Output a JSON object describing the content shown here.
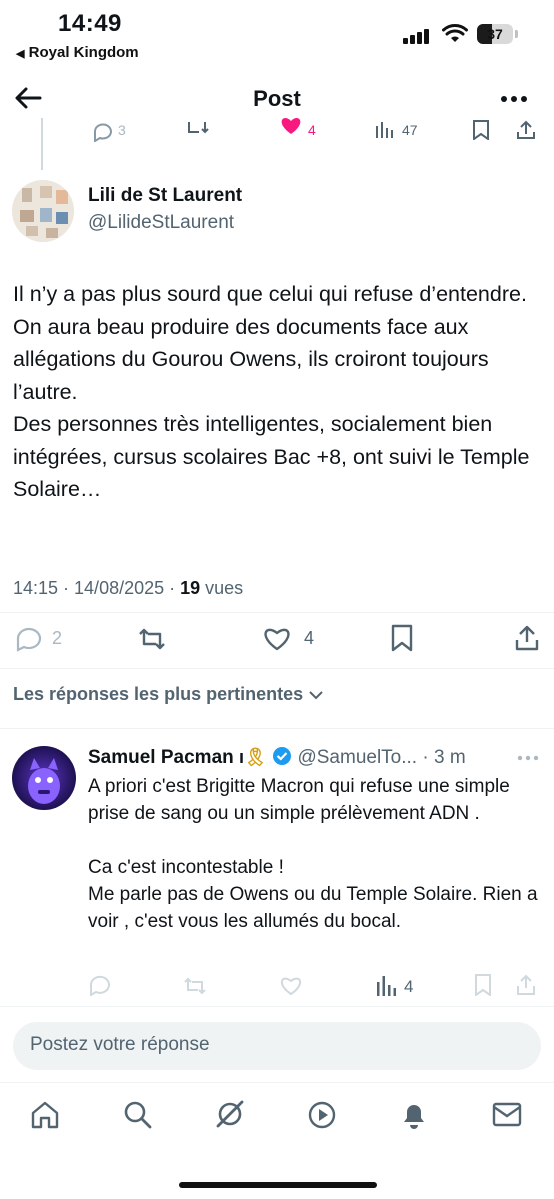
{
  "status_bar": {
    "time": "14:49",
    "carrier": "Royal Kingdom",
    "battery": "37"
  },
  "header": {
    "title": "Post"
  },
  "prev_tweet_stats": {
    "replies": "3",
    "likes": "4",
    "views": "47"
  },
  "tweet": {
    "author_name": "Lili de St Laurent",
    "author_handle": "@LilideStLaurent",
    "text": "Il n’y a pas plus sourd que celui qui refuse d’entendre.\nOn aura beau produire des documents face aux allégations du Gourou Owens, ils croiront toujours l’autre.\nDes personnes très intelligentes, socialement bien intégrées, cursus scolaires Bac +8, ont suivi le Temple Solaire…",
    "meta_time": "14:15 · 14/08/2025 · ",
    "views_count": "19",
    "views_label": " vues",
    "replies": "2",
    "likes": "4"
  },
  "replies_sort": {
    "label": "Les réponses les plus pertinentes"
  },
  "reply": {
    "author_name": "Samuel Pacman",
    "author_suffix": "🎗",
    "author_handle": "@SamuelTo...",
    "time": "· 3 m",
    "text": "A priori c'est Brigitte Macron qui refuse une simple prise de sang ou un simple prélèvement ADN .\n\nCa c'est incontestable !\nMe parle pas de Owens ou du Temple Solaire. Rien a voir , c'est vous les allumés du bocal.",
    "views": "4"
  },
  "composer": {
    "placeholder": "Postez votre réponse"
  },
  "colors": {
    "accent": "#1d9bf0",
    "like_pink": "#f91880",
    "text": "#0f1419",
    "muted": "#536471"
  }
}
